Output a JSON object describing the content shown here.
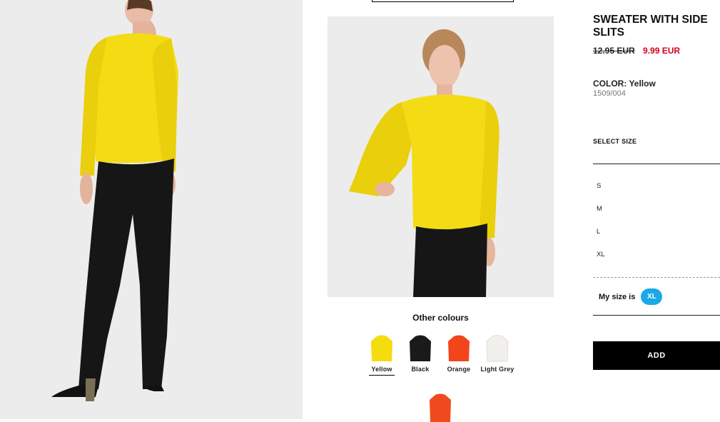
{
  "product": {
    "title": "SWEATER WITH SIDE SLITS",
    "old_price": "12.95 EUR",
    "new_price": "9.99 EUR",
    "colour_label": "COLOR:",
    "colour_value": "Yellow",
    "reference": "1509/004"
  },
  "size_selector": {
    "heading": "SELECT SIZE",
    "sizes": [
      "S",
      "M",
      "L",
      "XL"
    ],
    "my_size_label": "My size is",
    "my_size_value": "XL"
  },
  "add_button": {
    "label": "ADD"
  },
  "other_colours": {
    "title": "Other colours",
    "swatches": [
      {
        "label": "Yellow",
        "color": "#f5dc0f",
        "selected": true
      },
      {
        "label": "Black",
        "color": "#1a1a1a",
        "selected": false
      },
      {
        "label": "Orange",
        "color": "#f2461a",
        "selected": false
      },
      {
        "label": "Light Grey",
        "color": "#f2f0ec",
        "selected": false
      },
      {
        "label": "",
        "color": "#f04a1e",
        "selected": false
      }
    ]
  },
  "colors": {
    "sweater": "#f3dc14",
    "pants": "#161616",
    "sale_price": "#d0021b",
    "size_badge": "#1ba9e6"
  }
}
